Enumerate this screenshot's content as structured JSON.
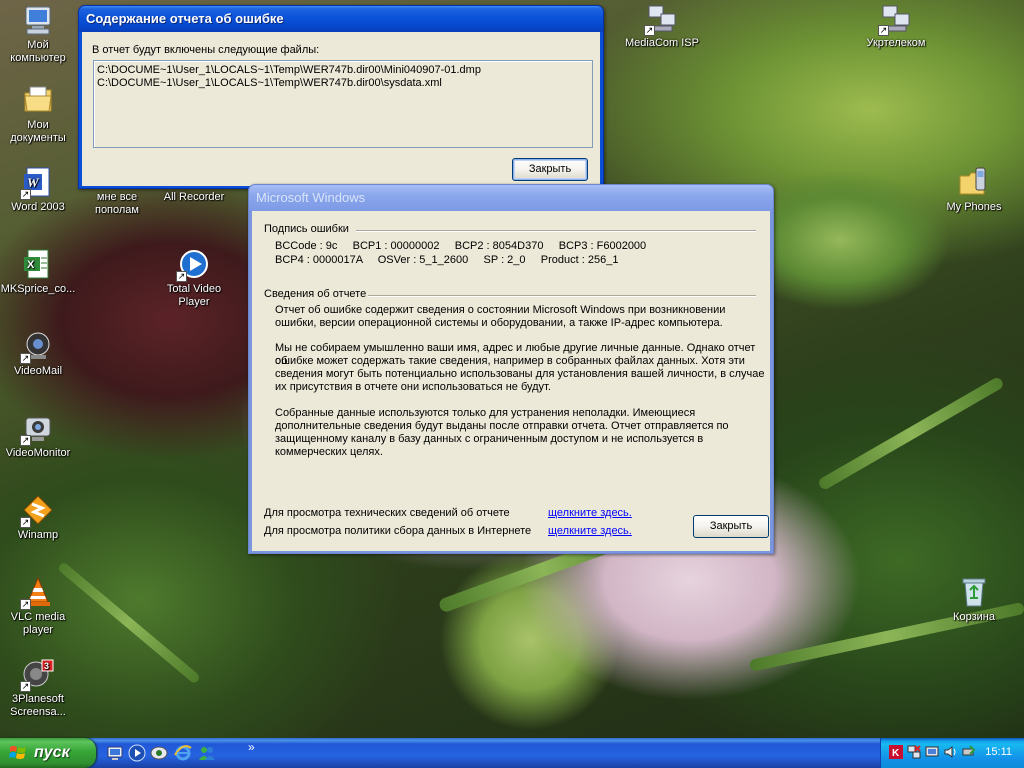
{
  "desktop": {
    "icons_left": [
      {
        "id": "my-computer",
        "label": "Мой компьютер"
      },
      {
        "id": "my-documents",
        "label": "Мои документы"
      },
      {
        "id": "word-2003",
        "label": "Word 2003"
      },
      {
        "id": "mksprice",
        "label": "MKSprice_co..."
      },
      {
        "id": "videomail",
        "label": "VideoMail"
      },
      {
        "id": "videomonitor",
        "label": "VideoMonitor"
      },
      {
        "id": "winamp",
        "label": "Winamp"
      },
      {
        "id": "vlc",
        "label": "VLC media player"
      },
      {
        "id": "3planesoft",
        "label": "3Planesoft Screensa..."
      }
    ],
    "icons_second": [
      {
        "id": "mne-vse-popolam",
        "label": "мне все пополам"
      },
      {
        "id": "all-recorder",
        "label": "All Recorder"
      },
      {
        "id": "total-video-player",
        "label": "Total Video Player"
      }
    ],
    "icons_right": [
      {
        "id": "mediacom-isp",
        "label": "MediaCom ISP"
      },
      {
        "id": "ukrtelecom",
        "label": "Укртелеком"
      },
      {
        "id": "my-phones",
        "label": "My Phones"
      },
      {
        "id": "recycle-bin",
        "label": "Корзина"
      }
    ]
  },
  "files_dialog": {
    "title": "Содержание отчета об ошибке",
    "intro": "В отчет будут включены следующие файлы:",
    "files": [
      "C:\\DOCUME~1\\User_1\\LOCALS~1\\Temp\\WER747b.dir00\\Mini040907-01.dmp",
      "C:\\DOCUME~1\\User_1\\LOCALS~1\\Temp\\WER747b.dir00\\sysdata.xml"
    ],
    "close_label": "Закрыть"
  },
  "report_dialog": {
    "title": "Microsoft Windows",
    "signature_heading": "Подпись ошибки",
    "signature_line1": "BCCode : 9c     BCP1 : 00000002     BCP2 : 8054D370     BCP3 : F6002000",
    "signature_line2": "BCP4 : 0000017A     OSVer : 5_1_2600     SP : 2_0     Product : 256_1",
    "details_heading": "Сведения об отчете",
    "para1_l1": "Отчет об ошибке содержит сведения о состоянии Microsoft Windows при возникновении",
    "para1_l2": "ошибки, версии операционной системы и оборудовании, а также IP-адрес компьютера.",
    "para2_l1": "Мы не собираем умышленно ваши имя, адрес и любые другие личные данные. Однако отчет об",
    "para2_l2": "ошибке может содержать такие сведения, например в собранных файлах данных. Хотя эти",
    "para2_l3": "сведения могут быть потенциально использованы для установления вашей личности, в случае",
    "para2_l4": "их присутствия в отчете они использоваться не будут.",
    "para3_l1": "Собранные данные используются только для устранения неполадки. Имеющиеся",
    "para3_l2": "дополнительные сведения будут выданы после отправки отчета. Отчет отправляется по",
    "para3_l3": "защищенному каналу в базу данных с ограниченным доступом и не используется в",
    "para3_l4": "коммерческих целях.",
    "tech_label": "Для просмотра технических сведений об отчете",
    "tech_link": "щелкните здесь.",
    "policy_label": "Для просмотра политики сбора данных в Интернете",
    "policy_link": "щелкните здесь.",
    "close_label": "Закрыть"
  },
  "taskbar": {
    "start_label": "пуск",
    "quick_launch": [
      "show-desktop-icon",
      "media-player-icon",
      "messenger-icon",
      "internet-explorer-icon",
      "msn-icon"
    ],
    "overflow": "»",
    "tray_icons": [
      "kaspersky-icon",
      "network-icon",
      "network-2-icon",
      "volume-icon",
      "safely-remove-icon"
    ],
    "clock": "15:11"
  },
  "colors": {
    "xp_blue": "#0a4fd6",
    "dialog_bg": "#ece9d8",
    "start_green": "#37a637",
    "link": "#0000ff"
  }
}
